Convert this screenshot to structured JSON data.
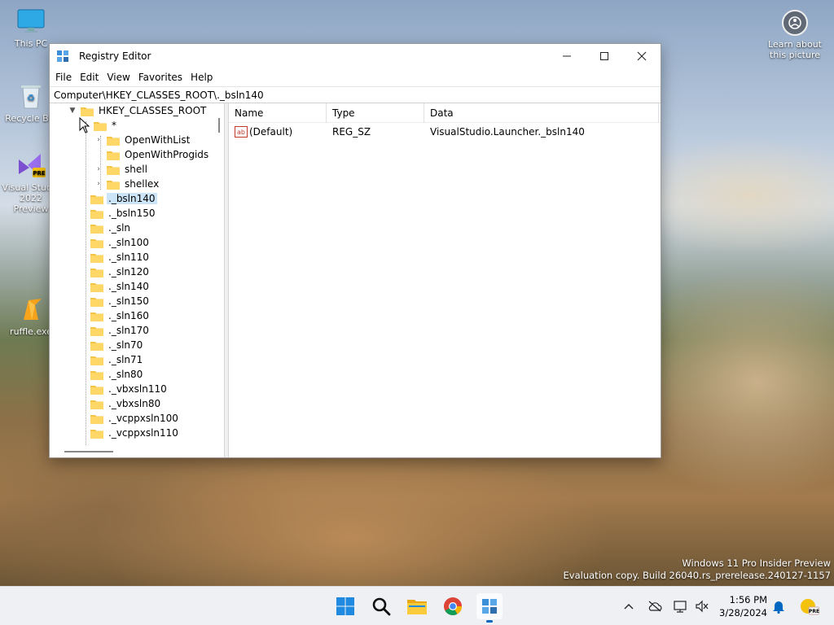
{
  "desktop": {
    "icons": [
      {
        "label": "This PC",
        "icon": "monitor-icon"
      },
      {
        "label": "Recycle Bin",
        "icon": "recycle-bin-icon"
      },
      {
        "label": "Visual Studio 2022 Preview",
        "icon": "visual-studio-icon"
      },
      {
        "label": "ruffle.exe",
        "icon": "ruffle-icon"
      }
    ],
    "learn_label": "Learn about this picture",
    "watermark": {
      "line1": "Windows 11 Pro Insider Preview",
      "line2": "Evaluation copy. Build 26040.rs_prerelease.240127-1157"
    }
  },
  "window": {
    "title": "Registry Editor",
    "menu": [
      "File",
      "Edit",
      "View",
      "Favorites",
      "Help"
    ],
    "address": "Computer\\HKEY_CLASSES_ROOT\\._bsln140",
    "tree": {
      "root": "HKEY_CLASSES_ROOT",
      "star": "*",
      "star_children": [
        "OpenWithList",
        "OpenWithProgids",
        "shell",
        "shellex"
      ],
      "items": [
        "._bsln140",
        "._bsln150",
        "._sln",
        "._sln100",
        "._sln110",
        "._sln120",
        "._sln140",
        "._sln150",
        "._sln160",
        "._sln170",
        "._sln70",
        "._sln71",
        "._sln80",
        "._vbxsln110",
        "._vbxsln80",
        "._vcppxsln100",
        "._vcppxsln110"
      ],
      "selected": "._bsln140"
    },
    "list": {
      "columns": [
        "Name",
        "Type",
        "Data"
      ],
      "rows": [
        {
          "name": "(Default)",
          "type": "REG_SZ",
          "data": "VisualStudio.Launcher._bsln140",
          "icon": "string-value-icon"
        }
      ]
    }
  },
  "taskbar": {
    "time": "1:56 PM",
    "date": "3/28/2024",
    "accent": "#0067c0"
  }
}
